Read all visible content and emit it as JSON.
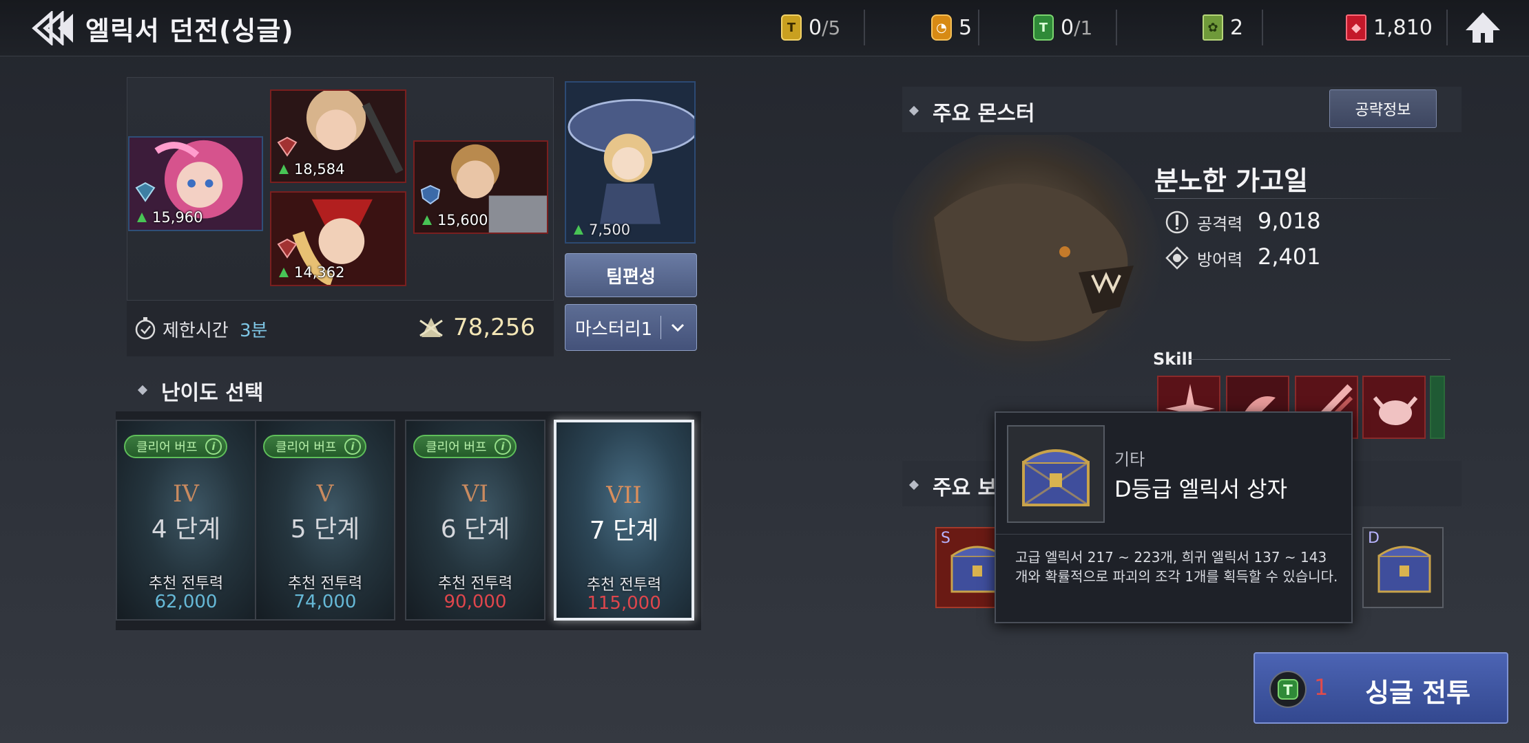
{
  "header": {
    "title": "엘릭서 던전(싱글)",
    "resources": [
      {
        "icon": "gold-ticket-icon",
        "value": "0",
        "max": "/5"
      },
      {
        "icon": "stamina-potion-icon",
        "value": "5",
        "max": ""
      },
      {
        "icon": "green-ticket-icon",
        "value": "0",
        "max": "/1"
      },
      {
        "icon": "green-card-icon",
        "value": "2",
        "max": ""
      },
      {
        "icon": "red-gem-icon",
        "value": "1,810",
        "max": ""
      }
    ]
  },
  "party": {
    "heroes": [
      {
        "name": "hero-pink-hair",
        "cp": "15,960"
      },
      {
        "name": "hero-blond-warrior",
        "cp": "18,584"
      },
      {
        "name": "hero-red-hat",
        "cp": "14,362"
      },
      {
        "name": "hero-brown-knight",
        "cp": "15,600"
      },
      {
        "name": "leader-witch",
        "cp": "7,500"
      }
    ],
    "team_button": "팀편성",
    "mastery_select": "마스터리1",
    "time_label": "제한시간",
    "time_value": "3분",
    "total_power": "78,256"
  },
  "difficulty": {
    "header": "난이도 선택",
    "cards": [
      {
        "roman": "IV",
        "stage": "4 단계",
        "buff": "클리어 버프",
        "rec_label": "추천 전투력",
        "rec_value": "62,000"
      },
      {
        "roman": "V",
        "stage": "5 단계",
        "buff": "클리어 버프",
        "rec_label": "추천 전투력",
        "rec_value": "74,000"
      },
      {
        "roman": "VI",
        "stage": "6 단계",
        "buff": "클리어 버프",
        "rec_label": "추천 전투력",
        "rec_value": "90,000"
      },
      {
        "roman": "VII",
        "stage": "7 단계",
        "buff": "",
        "rec_label": "추천 전투력",
        "rec_value": "115,000"
      }
    ],
    "selected_index": 3
  },
  "monster": {
    "header": "주요 몬스터",
    "strategy_button": "공략정보",
    "name": "분노한 가고일",
    "attack_label": "공격력",
    "attack_value": "9,018",
    "defense_label": "방어력",
    "defense_value": "2,401",
    "skill_label": "Skill"
  },
  "rewards": {
    "header": "주요 보",
    "items": [
      {
        "grade": "S",
        "icon": "treasure-chest-icon"
      },
      {
        "grade": "D",
        "icon": "treasure-chest-icon"
      }
    ]
  },
  "tooltip": {
    "category": "기타",
    "title": "D등급 엘릭서 상자",
    "description": "고급 엘릭서 217 ~ 223개, 희귀 엘릭서 137 ~ 143개와 확률적으로 파괴의 조각 1개를 획득할 수 있습니다."
  },
  "battle": {
    "ticket_count": "1",
    "label": "싱글 전투"
  },
  "colors": {
    "accent_blue": "#4c64b4",
    "recommended_ok": "#66b9d7",
    "recommended_high": "#e0464c",
    "buff_green": "#5fbf5a"
  }
}
